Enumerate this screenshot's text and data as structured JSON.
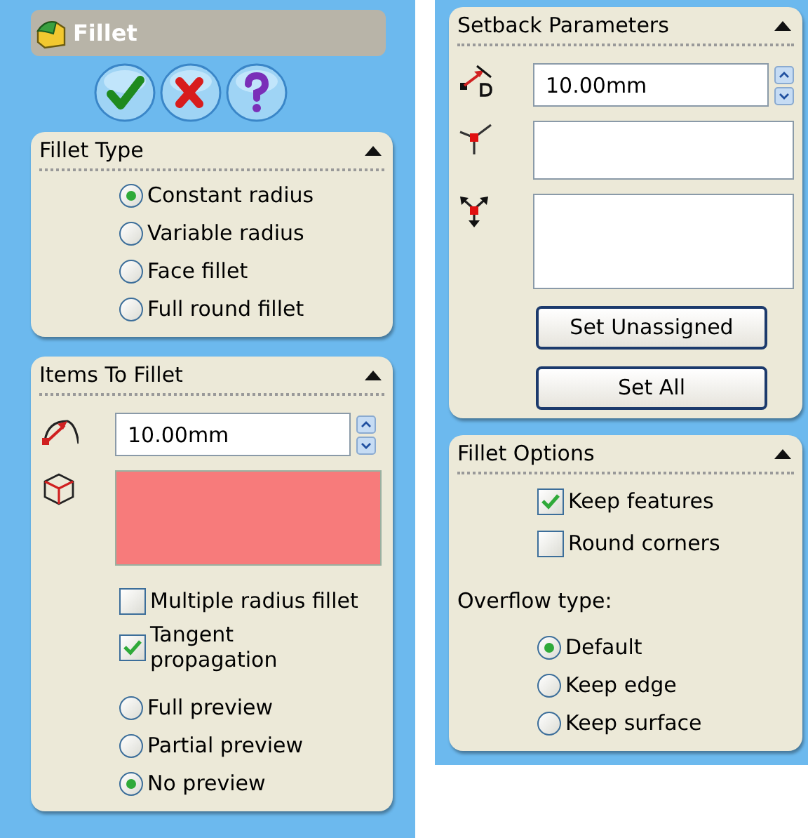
{
  "title": "Fillet",
  "actions": [
    {
      "kind": "ok"
    },
    {
      "kind": "cancel"
    },
    {
      "kind": "help"
    }
  ],
  "columns": [
    {
      "panels": [
        {
          "title": "Fillet Type",
          "expanded": true,
          "items": [
            {
              "kind": "radio",
              "label": "Constant radius",
              "selected": true
            },
            {
              "kind": "radio",
              "label": "Variable radius",
              "selected": false
            },
            {
              "kind": "radio",
              "label": "Face fillet",
              "selected": false
            },
            {
              "kind": "radio",
              "label": "Full round fillet",
              "selected": false
            }
          ]
        },
        {
          "title": "Items To Fillet",
          "expanded": true,
          "items": [
            {
              "kind": "value_field",
              "value": "10.00mm"
            },
            {
              "kind": "selection_box",
              "active": true
            },
            {
              "kind": "checkbox",
              "label": "Multiple radius fillet",
              "checked": false
            },
            {
              "kind": "checkbox",
              "label": "Tangent propagation",
              "checked": true
            },
            {
              "kind": "radio",
              "label": "Full preview",
              "selected": false
            },
            {
              "kind": "radio",
              "label": "Partial preview",
              "selected": false
            },
            {
              "kind": "radio",
              "label": "No preview",
              "selected": true
            }
          ]
        }
      ]
    },
    {
      "panels": [
        {
          "title": "Setback Parameters",
          "expanded": true,
          "items": [
            {
              "kind": "value_field",
              "value": "10.00mm"
            },
            {
              "kind": "selection_box",
              "active": false
            },
            {
              "kind": "selection_box",
              "active": false
            },
            {
              "kind": "button",
              "label": "Set Unassigned"
            },
            {
              "kind": "button",
              "label": "Set All"
            }
          ]
        },
        {
          "title": "Fillet Options",
          "expanded": true,
          "items": [
            {
              "kind": "checkbox",
              "label": "Keep features",
              "checked": true
            },
            {
              "kind": "checkbox",
              "label": "Round corners",
              "checked": false
            },
            {
              "kind": "caption",
              "text": "Overflow type:"
            },
            {
              "kind": "radio",
              "label": "Default",
              "selected": true
            },
            {
              "kind": "radio",
              "label": "Keep edge",
              "selected": false
            },
            {
              "kind": "radio",
              "label": "Keep surface",
              "selected": false
            }
          ]
        }
      ]
    }
  ]
}
